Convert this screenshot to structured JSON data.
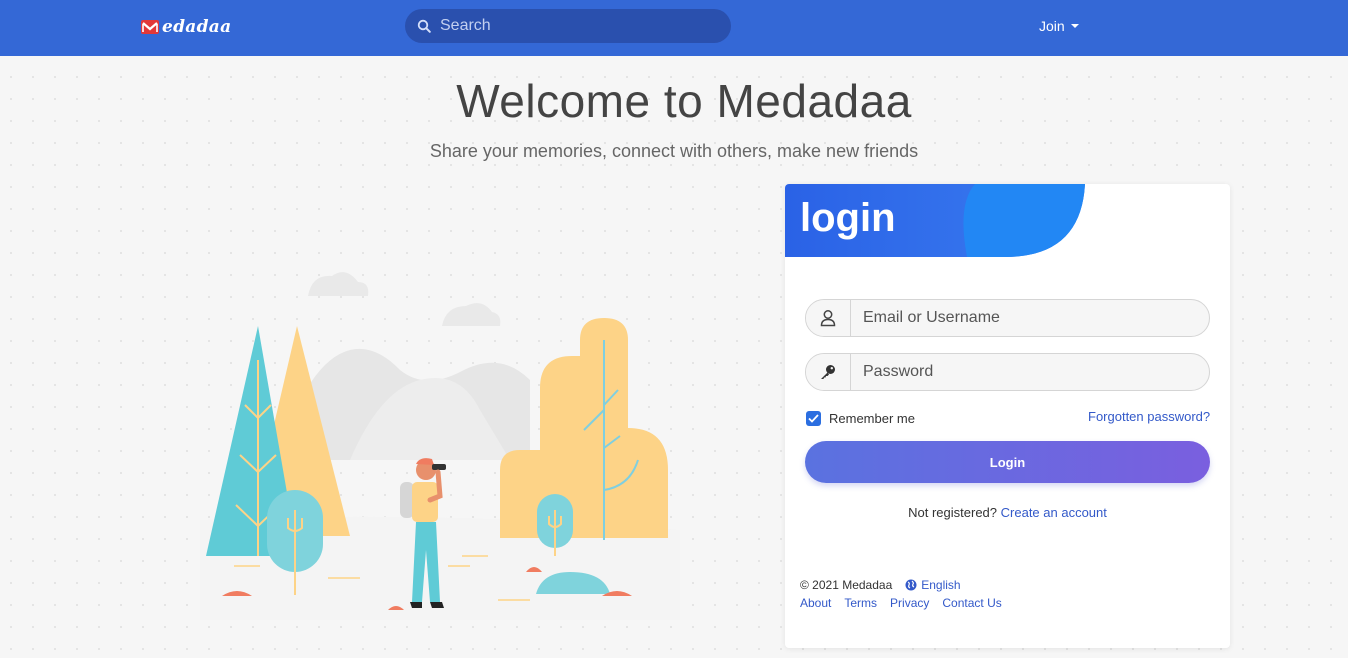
{
  "header": {
    "logo_text": "edadaa",
    "search_placeholder": "Search",
    "join_label": "Join",
    "bar_color": "#3468d6"
  },
  "hero": {
    "title": "Welcome to Medadaa",
    "subtitle": "Share your memories, connect with others, make new friends"
  },
  "login": {
    "title": "login",
    "username_placeholder": "Email or Username",
    "password_placeholder": "Password",
    "remember_label": "Remember me",
    "forgot_label": "Forgotten password?",
    "submit_label": "Login",
    "not_registered": "Not registered?",
    "create_account": "Create an account",
    "icons": [
      "user-icon",
      "key-icon",
      "check-icon"
    ]
  },
  "footer": {
    "copyright": "© 2021 Medadaa",
    "language": "English",
    "links": [
      "About",
      "Terms",
      "Privacy",
      "Contact Us"
    ]
  }
}
